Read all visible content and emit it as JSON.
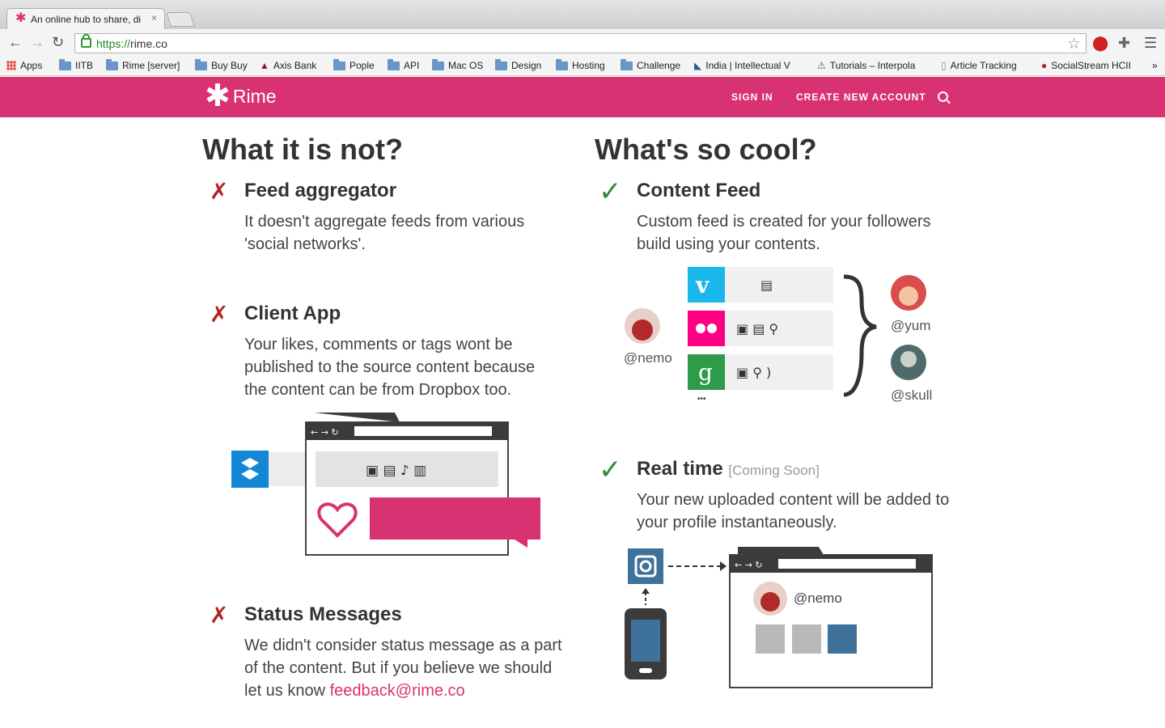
{
  "browser": {
    "tab_title": "An online hub to share, di",
    "tab_close": "×",
    "url_scheme": "https://",
    "url_host": "rime.co",
    "bookmarks": [
      "Apps",
      "IITB",
      "Rime [server]",
      "Buy Buy",
      "Axis Bank",
      "Pople",
      "API",
      "Mac OS",
      "Design",
      "Hosting",
      "Challenge",
      "India | Intellectual V",
      "Tutorials – Interpola",
      "Article Tracking",
      "SocialStream HCII"
    ],
    "more_bookmarks": "»"
  },
  "header": {
    "logo_mark": "✱",
    "logo_text": "Rime",
    "sign_in": "SIGN IN",
    "create_account": "CREATE NEW ACCOUNT"
  },
  "left": {
    "heading": "What it is not?",
    "items": [
      {
        "title": "Feed aggregator",
        "desc1": "It doesn't aggregate feeds from various",
        "desc2": "'social networks'."
      },
      {
        "title": "Client App",
        "desc1": "Your likes, comments or tags wont be",
        "desc2": "published to the source content because",
        "desc3": "the content can be from Dropbox too."
      },
      {
        "title": "Status Messages",
        "desc1": "We didn't consider status message as a part",
        "desc2": "of the content. But if you believe we should",
        "desc3_prefix": "let us know ",
        "desc3_link": "feedback@rime.co"
      }
    ]
  },
  "right": {
    "heading": "What's so cool?",
    "items": [
      {
        "title": "Content Feed",
        "desc1": "Custom feed is created for your followers",
        "desc2": "build using your contents."
      },
      {
        "title": "Real time",
        "soon": "[Coming Soon]",
        "desc1": "Your new uploaded content will be added to",
        "desc2": "your profile instantaneously."
      }
    ],
    "feed_users": {
      "source": "@nemo",
      "follower1": "@yum",
      "follower2": "@skull",
      "more": "•••"
    },
    "realtime_user": "@nemo"
  },
  "colors": {
    "brand": "#d93272",
    "cross": "#b62222",
    "check": "#2c8a3c"
  }
}
